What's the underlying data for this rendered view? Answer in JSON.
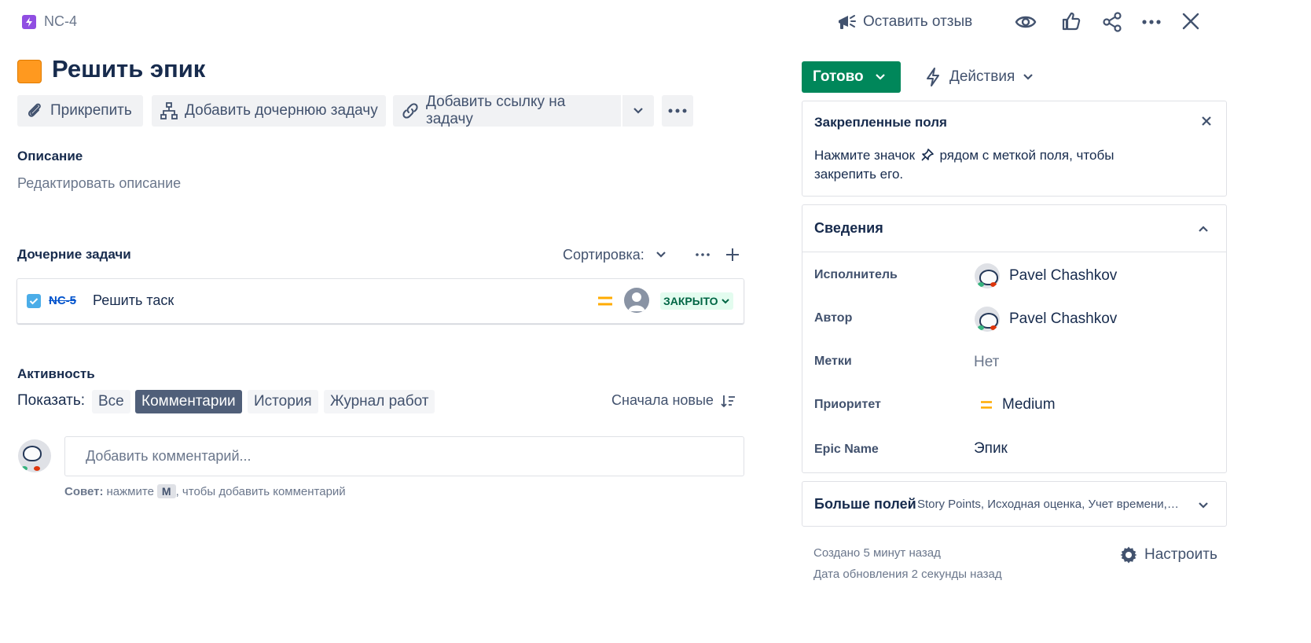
{
  "header": {
    "issue_key": "NC-4",
    "feedback_label": "Оставить отзыв",
    "icons": [
      "megaphone-icon",
      "eye-icon",
      "thumbs-up-icon",
      "share-icon",
      "more-icon",
      "close-icon"
    ]
  },
  "issue": {
    "title": "Решить эпик",
    "type_color": "#ff991f"
  },
  "toolbar": {
    "attach_label": "Прикрепить",
    "add_child_label": "Добавить дочернюю задачу",
    "add_link_label": "Добавить ссылку на задачу"
  },
  "description": {
    "heading": "Описание",
    "placeholder": "Редактировать описание"
  },
  "child_issues": {
    "heading": "Дочерние задачи",
    "sort_label": "Сортировка:",
    "items": [
      {
        "key": "NC-5",
        "summary": "Решить таск",
        "status": "ЗАКРЫТО"
      }
    ]
  },
  "activity": {
    "heading": "Активность",
    "show_label": "Показать:",
    "tabs": [
      "Все",
      "Комментарии",
      "История",
      "Журнал работ"
    ],
    "active_tab": "Комментарии",
    "sort_label": "Сначала новые",
    "comment_placeholder": "Добавить комментарий...",
    "tip_bold": "Совет:",
    "tip_text_1": "нажмите",
    "tip_key": "M",
    "tip_text_2": ", чтобы добавить комментарий"
  },
  "sidebar": {
    "status_button": "Готово",
    "status_color": "#00875a",
    "actions_label": "Действия",
    "pinned": {
      "title": "Закрепленные поля",
      "text_1": "Нажмите значок",
      "text_2": "рядом с меткой поля, чтобы",
      "text_3": "закрепить его."
    },
    "details": {
      "title": "Сведения",
      "assignee_label": "Исполнитель",
      "assignee": "Pavel Chashkov",
      "reporter_label": "Автор",
      "reporter": "Pavel Chashkov",
      "labels_label": "Метки",
      "labels_value": "Нет",
      "priority_label": "Приоритет",
      "priority_value": "Medium",
      "epic_name_label": "Epic Name",
      "epic_name_value": "Эпик"
    },
    "more_fields": {
      "title": "Больше полей",
      "summary": "Story Points, Исходная оценка, Учет времени,…"
    },
    "created": "Создано 5 минут назад",
    "updated": "Дата обновления 2 секунды назад",
    "configure_label": "Настроить"
  }
}
